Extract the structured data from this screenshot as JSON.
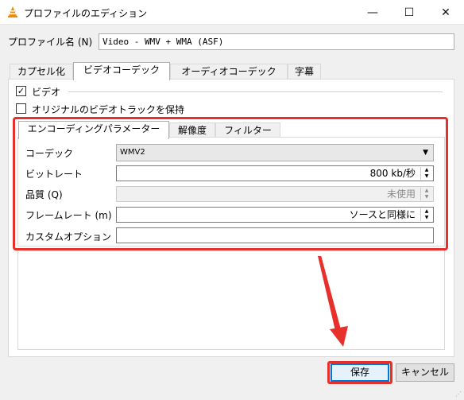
{
  "window": {
    "title": "プロファイルのエディション",
    "icon": "vlc-cone-icon",
    "controls": {
      "minimize": "—",
      "maximize": "☐",
      "close": "✕"
    }
  },
  "profile": {
    "label": "プロファイル名 (N)",
    "value": "Video - WMV + WMA (ASF)"
  },
  "main_tabs": [
    {
      "label": "カプセル化",
      "active": false
    },
    {
      "label": "ビデオコーデック",
      "active": true
    },
    {
      "label": "オーディオコーデック",
      "active": false
    },
    {
      "label": "字幕",
      "active": false
    }
  ],
  "video_section": {
    "video_checkbox_label": "ビデオ",
    "video_checked": true,
    "keep_track_label": "オリジナルのビデオトラックを保持",
    "keep_track_checked": false,
    "check_mark": "✓"
  },
  "inner_tabs": [
    {
      "label": "エンコーディングパラメーター",
      "active": true
    },
    {
      "label": "解像度",
      "active": false
    },
    {
      "label": "フィルター",
      "active": false
    }
  ],
  "encoding": {
    "codec_label": "コーデック",
    "codec_value": "WMV2",
    "bitrate_label": "ビットレート",
    "bitrate_value": "800 kb/秒",
    "quality_label": "品質 (Q)",
    "quality_value": "未使用",
    "framerate_label": "フレームレート (m)",
    "framerate_value": "ソースと同様に",
    "custom_label": "カスタムオプション",
    "custom_value": ""
  },
  "buttons": {
    "save": "保存",
    "cancel": "キャンセル"
  },
  "colors": {
    "highlight": "#e8302b",
    "accent": "#0078d7"
  }
}
